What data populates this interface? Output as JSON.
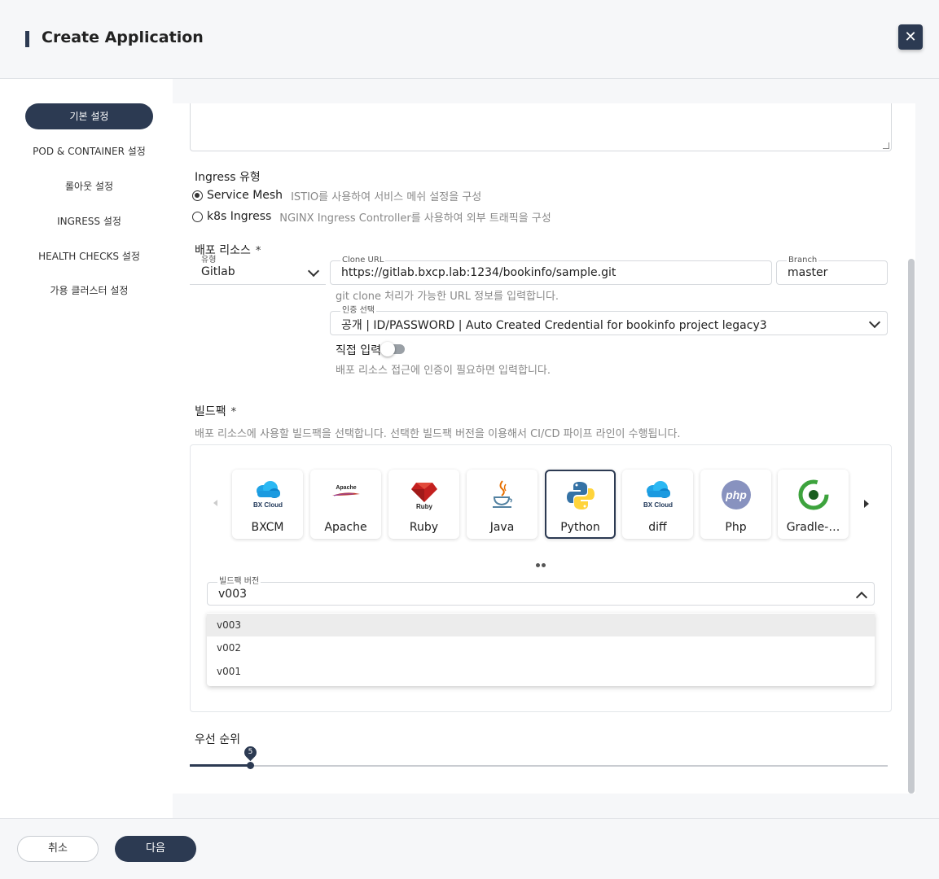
{
  "header": {
    "title": "Create Application",
    "close_label": "✕"
  },
  "sidebar": {
    "items": [
      {
        "label": "기본 설정",
        "active": true
      },
      {
        "label": "POD & CONTAINER 설정"
      },
      {
        "label": "롤아웃 설정"
      },
      {
        "label": "INGRESS 설정"
      },
      {
        "label": "HEALTH CHECKS 설정"
      },
      {
        "label": "가용 클러스터 설정"
      }
    ]
  },
  "ingress": {
    "title": "Ingress 유형",
    "options": [
      {
        "label": "Service Mesh",
        "desc": "ISTIO를 사용하여 서비스 메쉬 설정을 구성",
        "checked": true
      },
      {
        "label": "k8s Ingress",
        "desc": "NGINX Ingress Controller를 사용하여 외부 트래픽을 구성",
        "checked": false
      }
    ]
  },
  "deploy": {
    "title": "배포 리소스",
    "required_mark": "*",
    "type": {
      "label": "유형",
      "value": "Gitlab"
    },
    "clone_url": {
      "label": "Clone URL",
      "value": "https://gitlab.bxcp.lab:1234/bookinfo/sample.git",
      "hint": "git clone 처리가 가능한 URL 정보를 입력합니다."
    },
    "branch": {
      "label": "Branch",
      "value": "master"
    },
    "auth": {
      "label": "인증 선택",
      "value": "공개 | ID/PASSWORD | Auto Created Credential for bookinfo project legacy3"
    },
    "manual": {
      "label": "직접 입력",
      "hint": "배포 리소스 접근에 인증이 필요하면 입력합니다."
    }
  },
  "buildpack": {
    "title": "빌드팩",
    "required_mark": "*",
    "desc": "배포 리소스에 사용할 빌드팩을 선택합니다. 선택한 빌드팩 버전을 이용해서 CI/CD 파이프 라인이 수행됩니다.",
    "cards": [
      {
        "name": "BXCM",
        "icon": "bx-cloud-icon",
        "logo_text": "BX Cloud"
      },
      {
        "name": "Apache",
        "icon": "apache-feather-icon",
        "logo_text": "Apache"
      },
      {
        "name": "Ruby",
        "icon": "ruby-gem-icon",
        "logo_text": "Ruby"
      },
      {
        "name": "Java",
        "icon": "java-cup-icon",
        "logo_text": ""
      },
      {
        "name": "Python",
        "icon": "python-icon",
        "logo_text": "",
        "active": true
      },
      {
        "name": "diff",
        "icon": "bx-cloud-icon",
        "logo_text": "BX Cloud"
      },
      {
        "name": "Php",
        "icon": "php-icon",
        "logo_text": "php"
      },
      {
        "name": "Gradle-…",
        "icon": "gradle-icon",
        "logo_text": ""
      }
    ],
    "version": {
      "label": "빌드팩 버전",
      "value": "v003",
      "options": [
        "v003",
        "v002",
        "v001"
      ]
    }
  },
  "priority": {
    "title": "우선 순위",
    "value": 5,
    "min": 0,
    "max": 50
  },
  "footer": {
    "cancel_label": "취소",
    "next_label": "다음"
  },
  "colors": {
    "primary": "#2c3a52",
    "hint": "#888888",
    "border": "#d6d9dd"
  }
}
